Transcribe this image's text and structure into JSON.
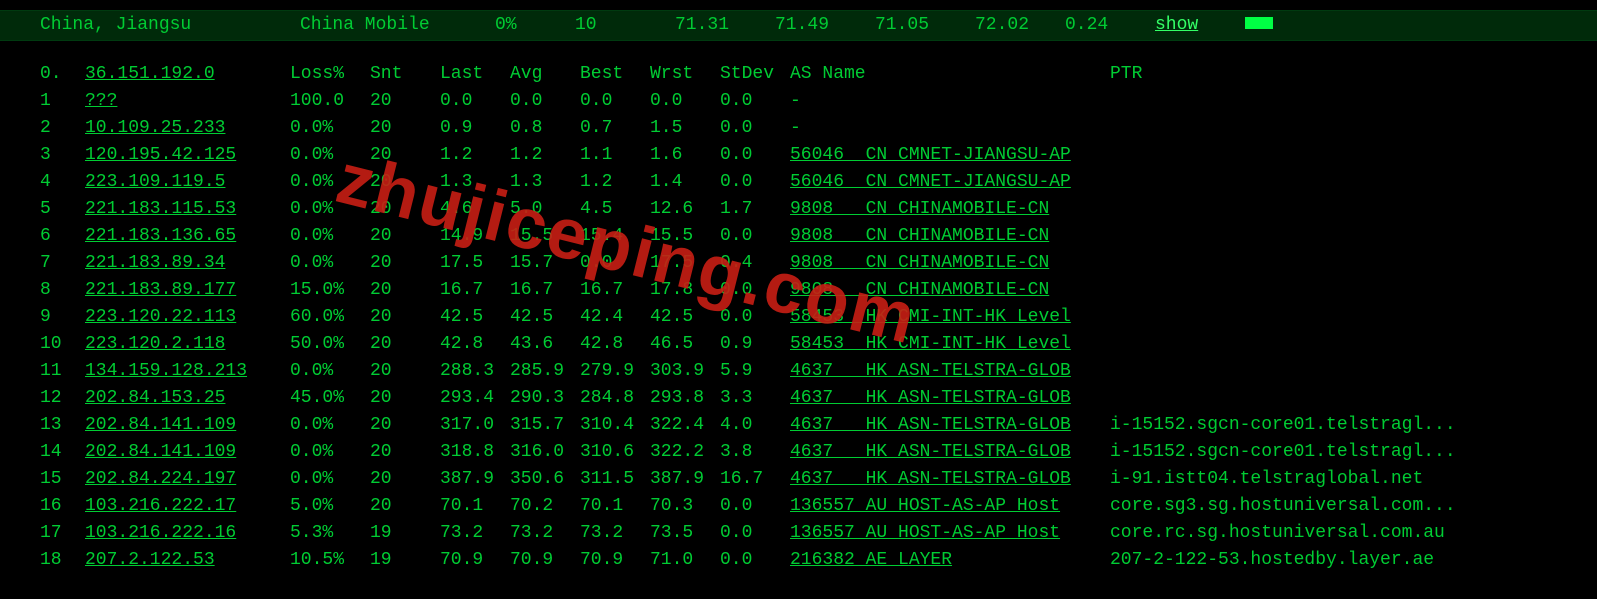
{
  "header": {
    "location": "China, Jiangsu",
    "isp": "China Mobile",
    "loss": "0%",
    "snt": "10",
    "v1": "71.31",
    "v2": "71.49",
    "v3": "71.05",
    "v4": "72.02",
    "v5": "0.24",
    "show": "show"
  },
  "columns": {
    "idx": "0.",
    "ip": "36.151.192.0",
    "loss": "Loss%",
    "snt": "Snt",
    "last": "Last",
    "avg": "Avg",
    "best": "Best",
    "wrst": "Wrst",
    "stdev": "StDev",
    "as": "AS Name",
    "ptr": "PTR"
  },
  "hops": [
    {
      "idx": "1",
      "ip": "???",
      "loss": "100.0",
      "snt": "20",
      "last": "0.0",
      "avg": "0.0",
      "best": "0.0",
      "wrst": "0.0",
      "stdev": "0.0",
      "as": "-",
      "ptr": ""
    },
    {
      "idx": "2",
      "ip": "10.109.25.233",
      "loss": "0.0%",
      "snt": "20",
      "last": "0.9",
      "avg": "0.8",
      "best": "0.7",
      "wrst": "1.5",
      "stdev": "0.0",
      "as": "-",
      "ptr": ""
    },
    {
      "idx": "3",
      "ip": "120.195.42.125",
      "loss": "0.0%",
      "snt": "20",
      "last": "1.2",
      "avg": "1.2",
      "best": "1.1",
      "wrst": "1.6",
      "stdev": "0.0",
      "as": "56046  CN CMNET-JIANGSU-AP",
      "ptr": ""
    },
    {
      "idx": "4",
      "ip": "223.109.119.5",
      "loss": "0.0%",
      "snt": "20",
      "last": "1.3",
      "avg": "1.3",
      "best": "1.2",
      "wrst": "1.4",
      "stdev": "0.0",
      "as": "56046  CN CMNET-JIANGSU-AP",
      "ptr": ""
    },
    {
      "idx": "5",
      "ip": "221.183.115.53",
      "loss": "0.0%",
      "snt": "20",
      "last": "4.6",
      "avg": "5.0",
      "best": "4.5",
      "wrst": "12.6",
      "stdev": "1.7",
      "as": "9808   CN CHINAMOBILE-CN",
      "ptr": ""
    },
    {
      "idx": "6",
      "ip": "221.183.136.65",
      "loss": "0.0%",
      "snt": "20",
      "last": "14.9",
      "avg": "15.5",
      "best": "15.4",
      "wrst": "15.5",
      "stdev": "0.0",
      "as": "9808   CN CHINAMOBILE-CN",
      "ptr": ""
    },
    {
      "idx": "7",
      "ip": "221.183.89.34",
      "loss": "0.0%",
      "snt": "20",
      "last": "17.5",
      "avg": "15.7",
      "best": "0.0",
      "wrst": "17.5",
      "stdev": "0.4",
      "as": "9808   CN CHINAMOBILE-CN",
      "ptr": ""
    },
    {
      "idx": "8",
      "ip": "221.183.89.177",
      "loss": "15.0%",
      "snt": "20",
      "last": "16.7",
      "avg": "16.7",
      "best": "16.7",
      "wrst": "17.8",
      "stdev": "0.0",
      "as": "9808   CN CHINAMOBILE-CN",
      "ptr": ""
    },
    {
      "idx": "9",
      "ip": "223.120.22.113",
      "loss": "60.0%",
      "snt": "20",
      "last": "42.5",
      "avg": "42.5",
      "best": "42.4",
      "wrst": "42.5",
      "stdev": "0.0",
      "as": "58453  HK CMI-INT-HK Level",
      "ptr": ""
    },
    {
      "idx": "10",
      "ip": "223.120.2.118",
      "loss": "50.0%",
      "snt": "20",
      "last": "42.8",
      "avg": "43.6",
      "best": "42.8",
      "wrst": "46.5",
      "stdev": "0.9",
      "as": "58453  HK CMI-INT-HK Level",
      "ptr": ""
    },
    {
      "idx": "11",
      "ip": "134.159.128.213",
      "loss": "0.0%",
      "snt": "20",
      "last": "288.3",
      "avg": "285.9",
      "best": "279.9",
      "wrst": "303.9",
      "stdev": "5.9",
      "as": "4637   HK ASN-TELSTRA-GLOB",
      "ptr": ""
    },
    {
      "idx": "12",
      "ip": "202.84.153.25",
      "loss": "45.0%",
      "snt": "20",
      "last": "293.4",
      "avg": "290.3",
      "best": "284.8",
      "wrst": "293.8",
      "stdev": "3.3",
      "as": "4637   HK ASN-TELSTRA-GLOB",
      "ptr": ""
    },
    {
      "idx": "13",
      "ip": "202.84.141.109",
      "loss": "0.0%",
      "snt": "20",
      "last": "317.0",
      "avg": "315.7",
      "best": "310.4",
      "wrst": "322.4",
      "stdev": "4.0",
      "as": "4637   HK ASN-TELSTRA-GLOB",
      "ptr": "i-15152.sgcn-core01.telstragl..."
    },
    {
      "idx": "14",
      "ip": "202.84.141.109",
      "loss": "0.0%",
      "snt": "20",
      "last": "318.8",
      "avg": "316.0",
      "best": "310.6",
      "wrst": "322.2",
      "stdev": "3.8",
      "as": "4637   HK ASN-TELSTRA-GLOB",
      "ptr": "i-15152.sgcn-core01.telstragl..."
    },
    {
      "idx": "15",
      "ip": "202.84.224.197",
      "loss": "0.0%",
      "snt": "20",
      "last": "387.9",
      "avg": "350.6",
      "best": "311.5",
      "wrst": "387.9",
      "stdev": "16.7",
      "as": "4637   HK ASN-TELSTRA-GLOB",
      "ptr": "i-91.istt04.telstraglobal.net"
    },
    {
      "idx": "16",
      "ip": "103.216.222.17",
      "loss": "5.0%",
      "snt": "20",
      "last": "70.1",
      "avg": "70.2",
      "best": "70.1",
      "wrst": "70.3",
      "stdev": "0.0",
      "as": "136557 AU HOST-AS-AP Host",
      "ptr": "core.sg3.sg.hostuniversal.com..."
    },
    {
      "idx": "17",
      "ip": "103.216.222.16",
      "loss": "5.3%",
      "snt": "19",
      "last": "73.2",
      "avg": "73.2",
      "best": "73.2",
      "wrst": "73.5",
      "stdev": "0.0",
      "as": "136557 AU HOST-AS-AP Host",
      "ptr": "core.rc.sg.hostuniversal.com.au"
    },
    {
      "idx": "18",
      "ip": "207.2.122.53",
      "loss": "10.5%",
      "snt": "19",
      "last": "70.9",
      "avg": "70.9",
      "best": "70.9",
      "wrst": "71.0",
      "stdev": "0.0",
      "as": "216382 AE LAYER",
      "ptr": "207-2-122-53.hostedby.layer.ae"
    }
  ],
  "watermark": "zhujiceping.com"
}
